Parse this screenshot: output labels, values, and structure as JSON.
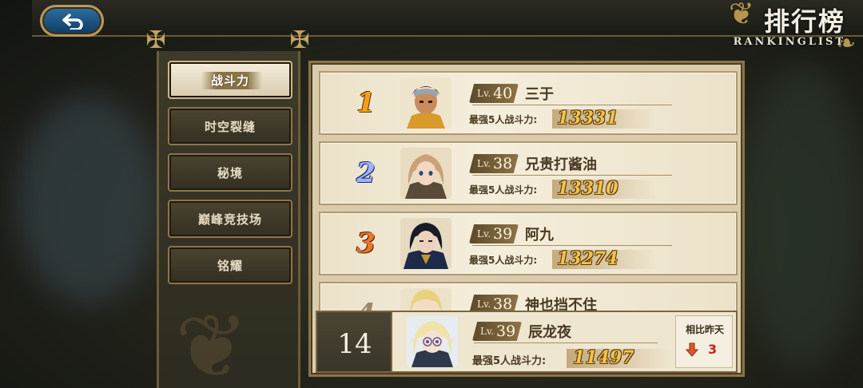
{
  "header": {
    "title": "排行榜",
    "subtitle": "RANKINGLIST"
  },
  "sidebar": {
    "items": [
      {
        "label": "战斗力",
        "active": true
      },
      {
        "label": "时空裂缝",
        "active": false
      },
      {
        "label": "秘境",
        "active": false
      },
      {
        "label": "巅峰竞技场",
        "active": false
      },
      {
        "label": "铭耀",
        "active": false
      }
    ]
  },
  "ranking": {
    "level_prefix": "Lv.",
    "power_label": "最强5人战斗力:",
    "rows": [
      {
        "rank": "1",
        "level": "40",
        "name": "三于",
        "power": "13331"
      },
      {
        "rank": "2",
        "level": "38",
        "name": "兄贵打酱油",
        "power": "13310"
      },
      {
        "rank": "3",
        "level": "39",
        "name": "阿九",
        "power": "13274"
      },
      {
        "rank": "4",
        "level": "38",
        "name": "神也挡不住",
        "power": ""
      }
    ]
  },
  "my_rank": {
    "rank": "14",
    "level": "39",
    "name": "辰龙夜",
    "power_label": "最强5人战斗力:",
    "power": "11497",
    "compare_label": "相比昨天",
    "change": "3",
    "change_direction": "down"
  },
  "colors": {
    "accent_gold": "#f2c24a",
    "rank1": "#f0a01c",
    "rank2": "#9fb4ff",
    "rank3": "#e8772a",
    "drop_red": "#c8231a"
  }
}
